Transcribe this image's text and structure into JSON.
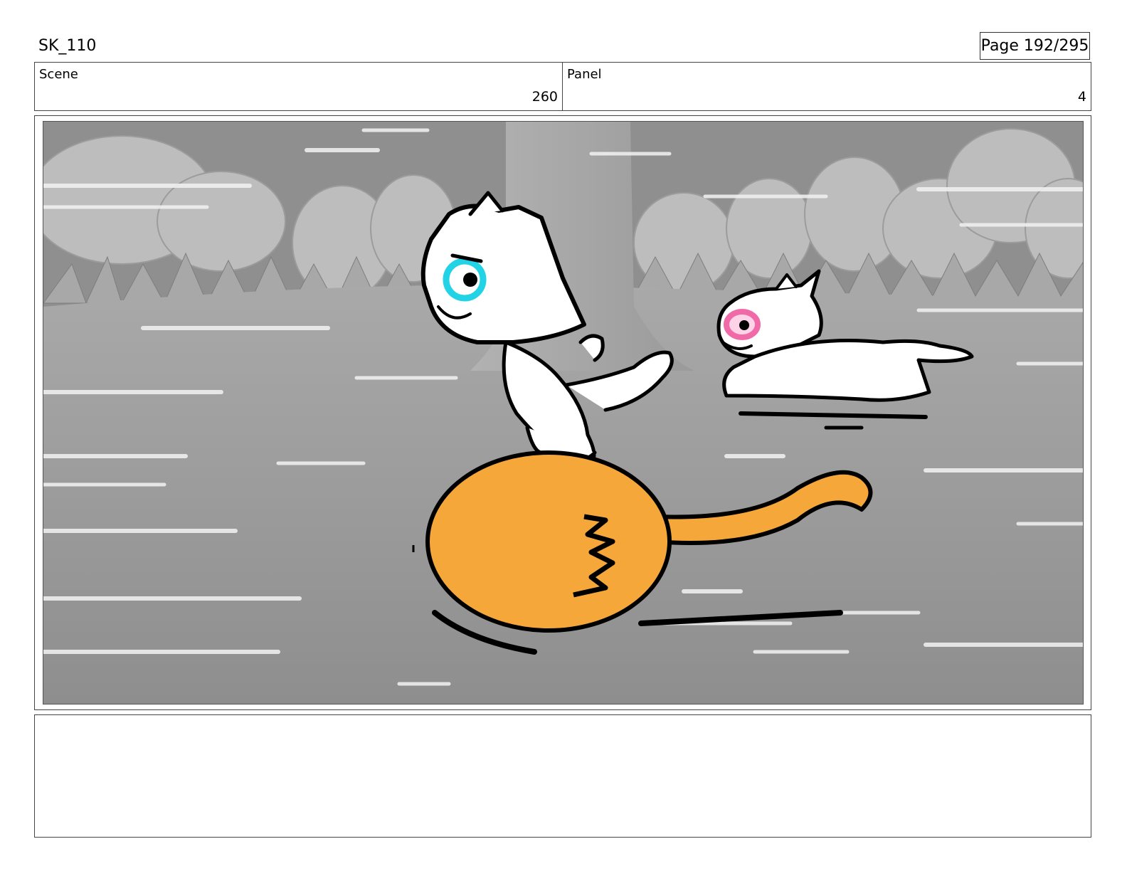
{
  "header": {
    "project_code": "SK_110",
    "page_indicator": "Page 192/295"
  },
  "info": {
    "scene_label": "Scene",
    "scene_value": "260",
    "panel_label": "Panel",
    "panel_value": "4"
  },
  "panel_image": {
    "icons": [
      "forest-background",
      "tree-trunk",
      "white-cat-character",
      "pink-eyed-cat-character",
      "orange-cat-ball"
    ],
    "colors": {
      "background_gray": "#8f8f8f",
      "ground_gray": "#9a9a9a",
      "orange_cat": "#f6a73a",
      "eye_cyan": "#22d3e6",
      "eye_pink": "#f06aa8"
    }
  },
  "notes": {
    "text": ""
  }
}
